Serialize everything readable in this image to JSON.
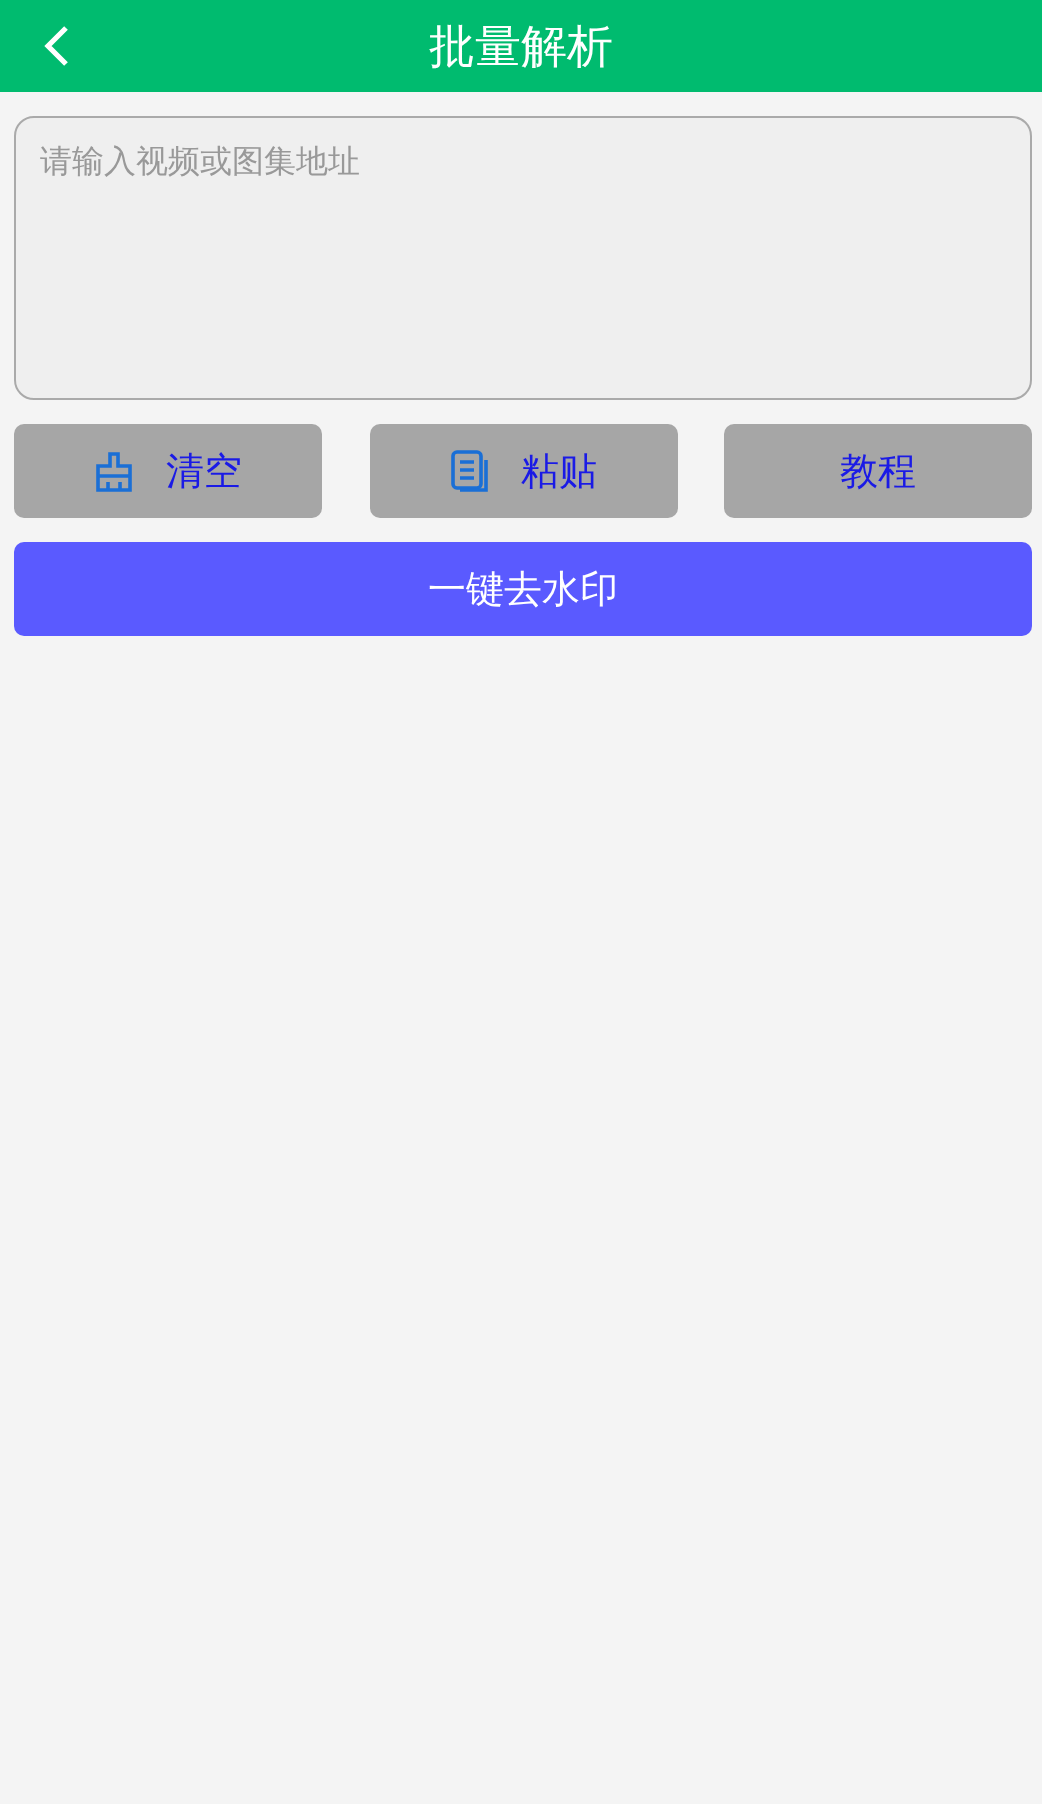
{
  "header": {
    "title": "批量解析"
  },
  "input": {
    "placeholder": "请输入视频或图集地址"
  },
  "buttons": [
    {
      "label": "清空",
      "kind": "broom"
    },
    {
      "label": "粘贴",
      "kind": "document"
    },
    {
      "label": "教程",
      "kind": "plain"
    }
  ],
  "primary_button": {
    "label": "一键去水印"
  }
}
